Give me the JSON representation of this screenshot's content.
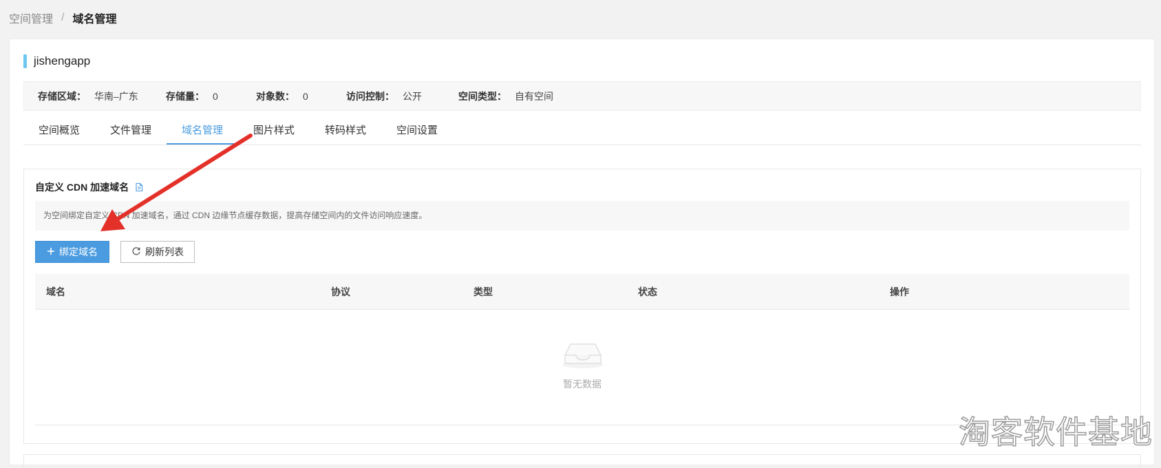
{
  "breadcrumb": {
    "parent": "空间管理",
    "separator": "/",
    "current": "域名管理"
  },
  "space": {
    "name": "jishengapp"
  },
  "info": {
    "region_label": "存储区域：",
    "region_value": "华南–广东",
    "storage_label": "存储量：",
    "storage_value": "0",
    "objects_label": "对象数：",
    "objects_value": "0",
    "access_label": "访问控制：",
    "access_value": "公开",
    "type_label": "空间类型：",
    "type_value": "自有空间"
  },
  "tabs": [
    {
      "label": "空间概览"
    },
    {
      "label": "文件管理"
    },
    {
      "label": "域名管理"
    },
    {
      "label": "图片样式"
    },
    {
      "label": "转码样式"
    },
    {
      "label": "空间设置"
    }
  ],
  "active_tab": 2,
  "cdn": {
    "title": "自定义 CDN 加速域名",
    "description": "为空间绑定自定义 CDN 加速域名，通过 CDN 边缘节点缓存数据，提高存储空间内的文件访问响应速度。",
    "bind_button": "绑定域名",
    "refresh_button": "刷新列表"
  },
  "table": {
    "columns": [
      "域名",
      "协议",
      "类型",
      "状态",
      "操作"
    ],
    "empty_text": "暂无数据"
  },
  "watermark": "淘客软件基地",
  "colors": {
    "accent": "#4a9be0",
    "title_bar": "#6ec6f0",
    "annotation_arrow": "#e3312a"
  },
  "icons": {
    "doc": "doc-icon",
    "plus": "plus-icon",
    "refresh": "refresh-icon",
    "empty": "empty-inbox-icon"
  }
}
